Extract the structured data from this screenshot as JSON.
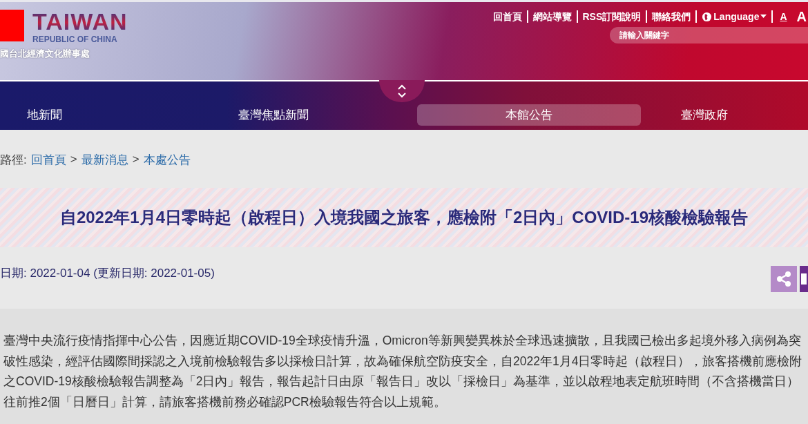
{
  "header": {
    "logo": {
      "title": "TAIWAN",
      "subtitle": "REPUBLIC OF CHINA"
    },
    "office_name": "國台北經濟文化辦事處",
    "top_links": [
      {
        "kind": "link",
        "label": "回首頁"
      },
      {
        "kind": "link",
        "label": "網站導覽"
      },
      {
        "kind": "link",
        "label": "RSS訂閱說明"
      },
      {
        "kind": "link",
        "label": "聯絡我們"
      },
      {
        "kind": "language",
        "label": "Language"
      },
      {
        "kind": "font-small",
        "label": "A"
      },
      {
        "kind": "font-large",
        "label": "A"
      }
    ],
    "search": {
      "placeholder": "請輸入關鍵字"
    }
  },
  "nav": {
    "menu_expanded": false,
    "items": [
      {
        "label": "地新聞",
        "selected": false
      },
      {
        "label": "臺灣焦點新聞",
        "selected": false
      },
      {
        "label": "本館公告",
        "selected": true
      },
      {
        "label": "臺灣政府",
        "selected": false
      }
    ]
  },
  "breadcrumb": {
    "label": "路徑:",
    "separator": ">",
    "links": [
      "回首頁",
      "最新消息",
      "本處公告"
    ]
  },
  "article": {
    "title": "自2022年1月4日零時起（啟程日）入境我國之旅客，應檢附「2日內」COVID-19核酸檢驗報告",
    "dates": "日期: 2022-01-04 (更新日期: 2022-01-05)",
    "actions": [
      {
        "kind": "share"
      },
      {
        "kind": "other"
      }
    ],
    "body": "臺灣中央流行疫情指揮中心公告，因應近期COVID-19全球疫情升溫，Omicron等新興變異株於全球迅速擴散，且我國已檢出多起境外移入病例為突破性感染，經評估國際間採認之入境前檢驗報告多以採檢日計算，故為確保航空防疫安全，自2022年1月4日零時起（啟程日），旅客搭機前應檢附之COVID-19核酸檢驗報告調整為「2日內」報告，報告起計日由原「報告日」改以「採檢日」為基準，並以啟程地表定航班時間（不含搭機當日）往前推2個「日曆日」計算，請旅客搭機前務必確認PCR檢驗報告符合以上規範。"
  }
}
